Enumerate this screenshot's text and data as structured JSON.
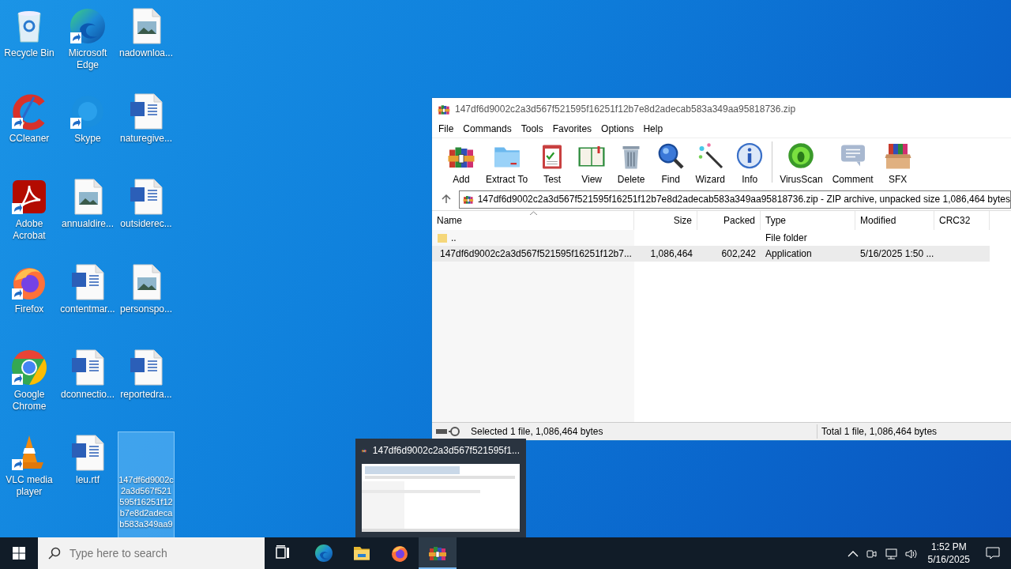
{
  "desktop": {
    "icons": [
      {
        "label": "Recycle Bin",
        "kind": "recycle",
        "shortcut": false,
        "selected": false
      },
      {
        "label": "Microsoft Edge",
        "kind": "edge",
        "shortcut": true,
        "selected": false
      },
      {
        "label": "nadownloa...",
        "kind": "image",
        "shortcut": false,
        "selected": false
      },
      {
        "label": "CCleaner",
        "kind": "ccleaner",
        "shortcut": true,
        "selected": false
      },
      {
        "label": "Skype",
        "kind": "skype",
        "shortcut": true,
        "selected": false
      },
      {
        "label": "naturegive...",
        "kind": "word",
        "shortcut": false,
        "selected": false
      },
      {
        "label": "Adobe Acrobat",
        "kind": "acrobat",
        "shortcut": true,
        "selected": false
      },
      {
        "label": "annualdire...",
        "kind": "image",
        "shortcut": false,
        "selected": false
      },
      {
        "label": "outsiderec...",
        "kind": "word",
        "shortcut": false,
        "selected": false
      },
      {
        "label": "Firefox",
        "kind": "firefox",
        "shortcut": true,
        "selected": false
      },
      {
        "label": "contentmar...",
        "kind": "word",
        "shortcut": false,
        "selected": false
      },
      {
        "label": "personspo...",
        "kind": "image",
        "shortcut": false,
        "selected": false
      },
      {
        "label": "Google Chrome",
        "kind": "chrome",
        "shortcut": true,
        "selected": false
      },
      {
        "label": "dconnectio...",
        "kind": "word",
        "shortcut": false,
        "selected": false
      },
      {
        "label": "reportedra...",
        "kind": "word",
        "shortcut": false,
        "selected": false
      },
      {
        "label": "VLC media player",
        "kind": "vlc",
        "shortcut": true,
        "selected": false
      },
      {
        "label": "leu.rtf",
        "kind": "word",
        "shortcut": false,
        "selected": false
      },
      {
        "label": "147df6d9002c2a3d567f521595f16251f12b7e8d2adecab583a349aa9",
        "kind": "blank",
        "shortcut": false,
        "selected": true
      }
    ]
  },
  "window": {
    "title": "147df6d9002c2a3d567f521595f16251f12b7e8d2adecab583a349aa95818736.zip",
    "menu": [
      "File",
      "Commands",
      "Tools",
      "Favorites",
      "Options",
      "Help"
    ],
    "toolbar": [
      "Add",
      "Extract To",
      "Test",
      "View",
      "Delete",
      "Find",
      "Wizard",
      "Info",
      "VirusScan",
      "Comment",
      "SFX"
    ],
    "address": "147df6d9002c2a3d567f521595f16251f12b7e8d2adecab583a349aa95818736.zip - ZIP archive, unpacked size 1,086,464 bytes",
    "columns": [
      {
        "label": "Name",
        "sorted": true
      },
      {
        "label": "Size",
        "sorted": false
      },
      {
        "label": "Packed",
        "sorted": false
      },
      {
        "label": "Type",
        "sorted": false
      },
      {
        "label": "Modified",
        "sorted": false
      },
      {
        "label": "CRC32",
        "sorted": false
      }
    ],
    "rows": [
      {
        "kind": "folder",
        "selected": false,
        "cells": [
          "..",
          "",
          "",
          "File folder",
          "",
          ""
        ]
      },
      {
        "kind": "exe",
        "selected": true,
        "cells": [
          "147df6d9002c2a3d567f521595f16251f12b7...",
          "1,086,464",
          "602,242",
          "Application",
          "5/16/2025 1:50 ...",
          ""
        ]
      }
    ],
    "status_left": "Selected 1 file, 1,086,464 bytes",
    "status_right": "Total 1 file, 1,086,464 bytes"
  },
  "thumbnail": {
    "title": "147df6d9002c2a3d567f521595f1..."
  },
  "taskbar": {
    "search_placeholder": "Type here to search",
    "apps": [
      {
        "kind": "taskview",
        "active": false
      },
      {
        "kind": "edge",
        "active": false
      },
      {
        "kind": "explorer",
        "active": false
      },
      {
        "kind": "firefox",
        "active": false
      },
      {
        "kind": "winrar",
        "active": true
      }
    ],
    "time": "1:52 PM",
    "date": "5/16/2025"
  }
}
